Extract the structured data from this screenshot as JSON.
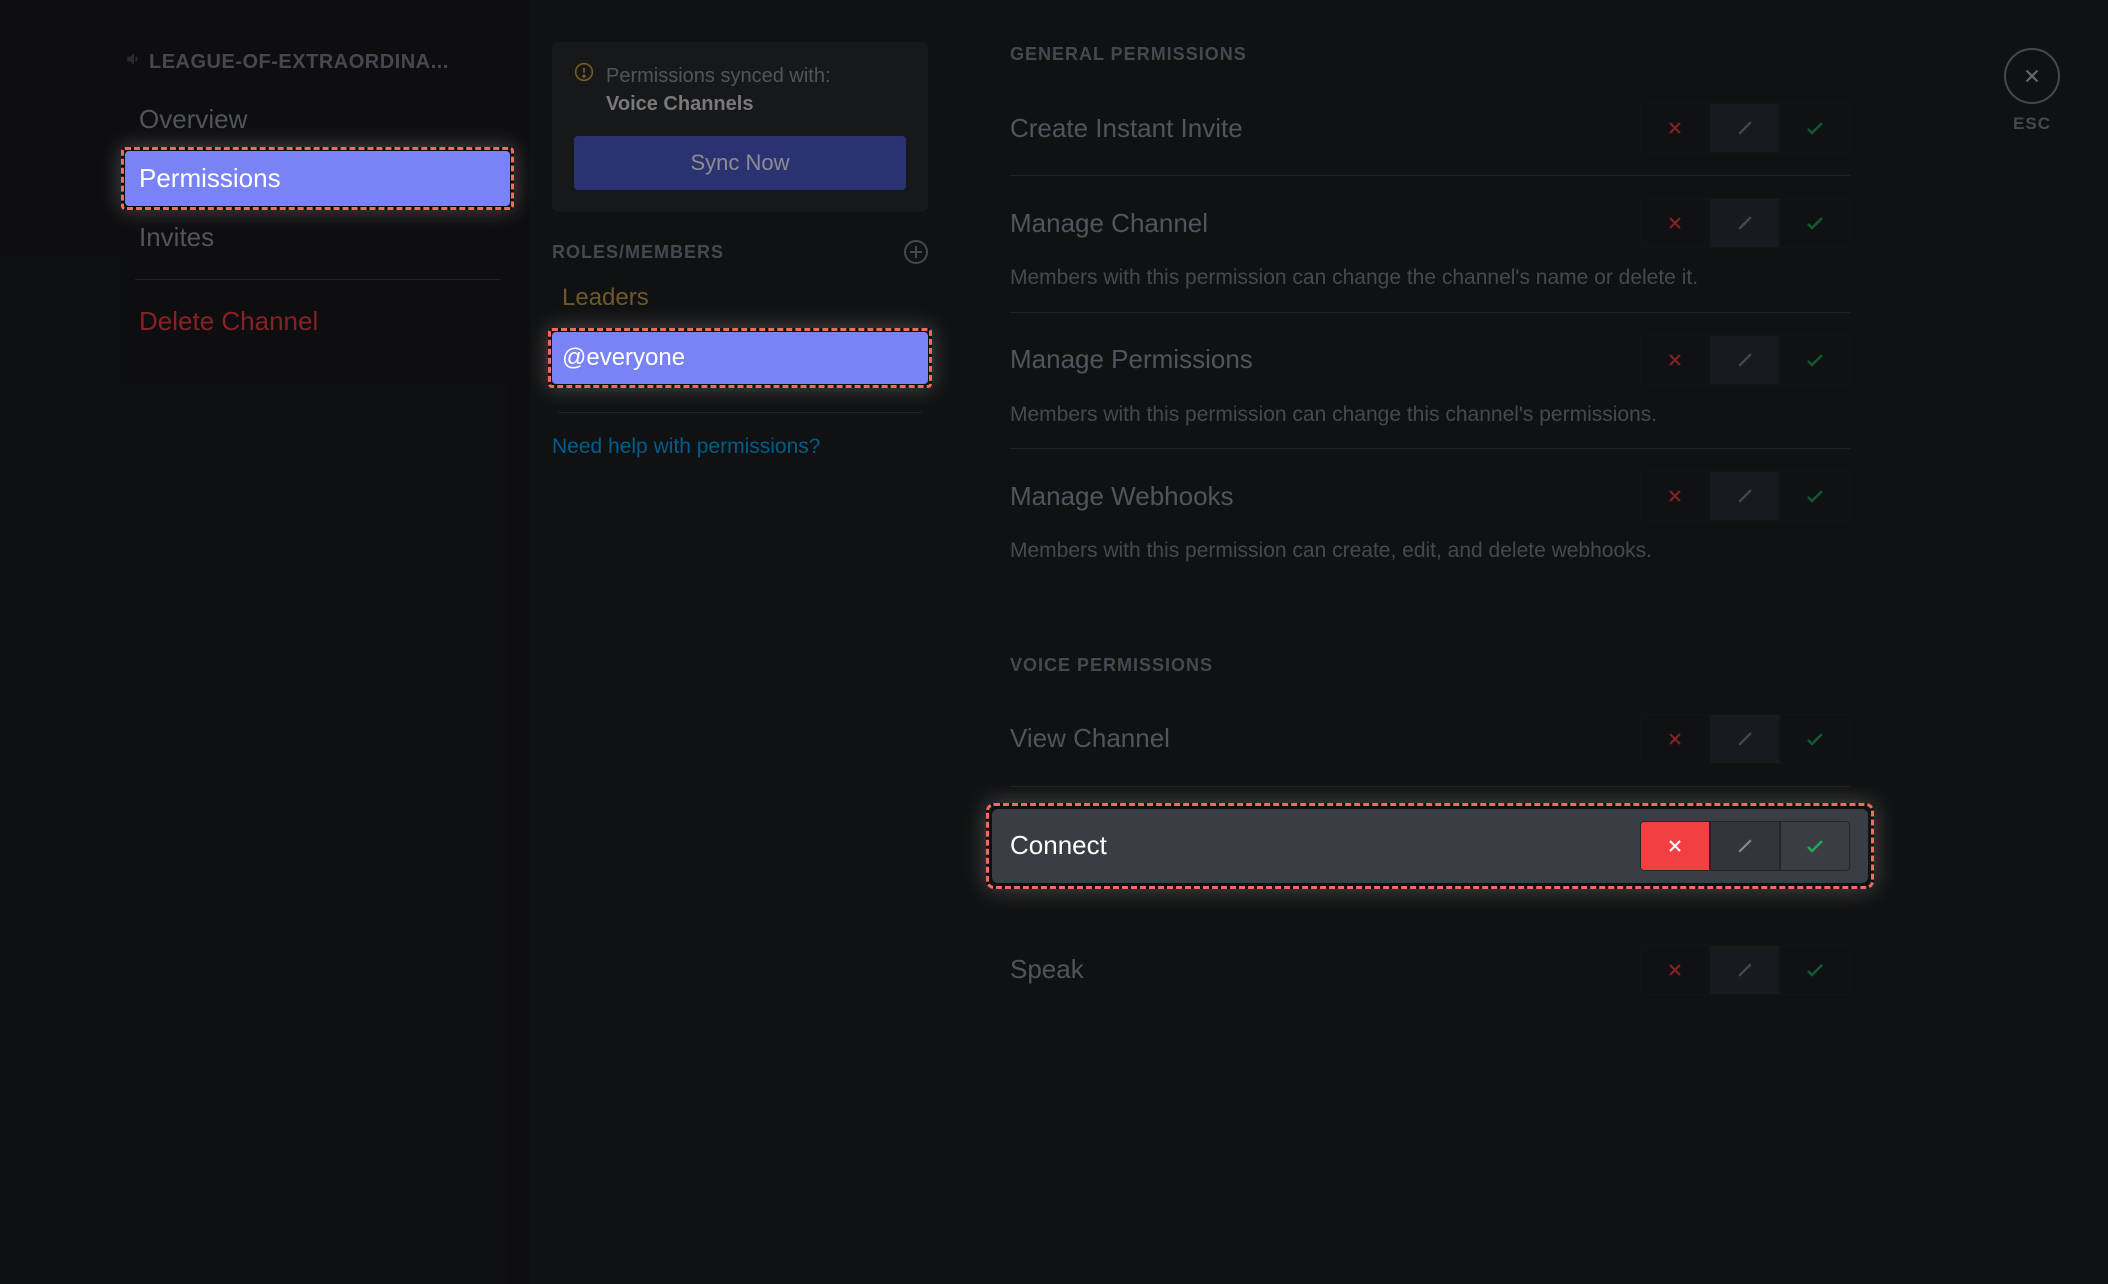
{
  "sidebar": {
    "channel_name": "LEAGUE-OF-EXTRAORDINA...",
    "items": {
      "overview": "Overview",
      "permissions": "Permissions",
      "invites": "Invites",
      "delete": "Delete Channel"
    }
  },
  "sync": {
    "line1": "Permissions synced with:",
    "category": "Voice Channels",
    "button": "Sync Now"
  },
  "roles": {
    "header": "ROLES/MEMBERS",
    "items": {
      "leaders": "Leaders",
      "everyone": "@everyone"
    },
    "help": "Need help with permissions?"
  },
  "sections": {
    "general": "GENERAL PERMISSIONS",
    "voice": "VOICE PERMISSIONS"
  },
  "perms": {
    "create_invite": {
      "title": "Create Instant Invite"
    },
    "manage_channel": {
      "title": "Manage Channel",
      "desc": "Members with this permission can change the channel's name or delete it."
    },
    "manage_permissions": {
      "title": "Manage Permissions",
      "desc": "Members with this permission can change this channel's permissions."
    },
    "manage_webhooks": {
      "title": "Manage Webhooks",
      "desc": "Members with this permission can create, edit, and delete webhooks."
    },
    "view_channel": {
      "title": "View Channel"
    },
    "connect": {
      "title": "Connect"
    },
    "speak": {
      "title": "Speak"
    }
  },
  "close": {
    "esc": "ESC"
  }
}
